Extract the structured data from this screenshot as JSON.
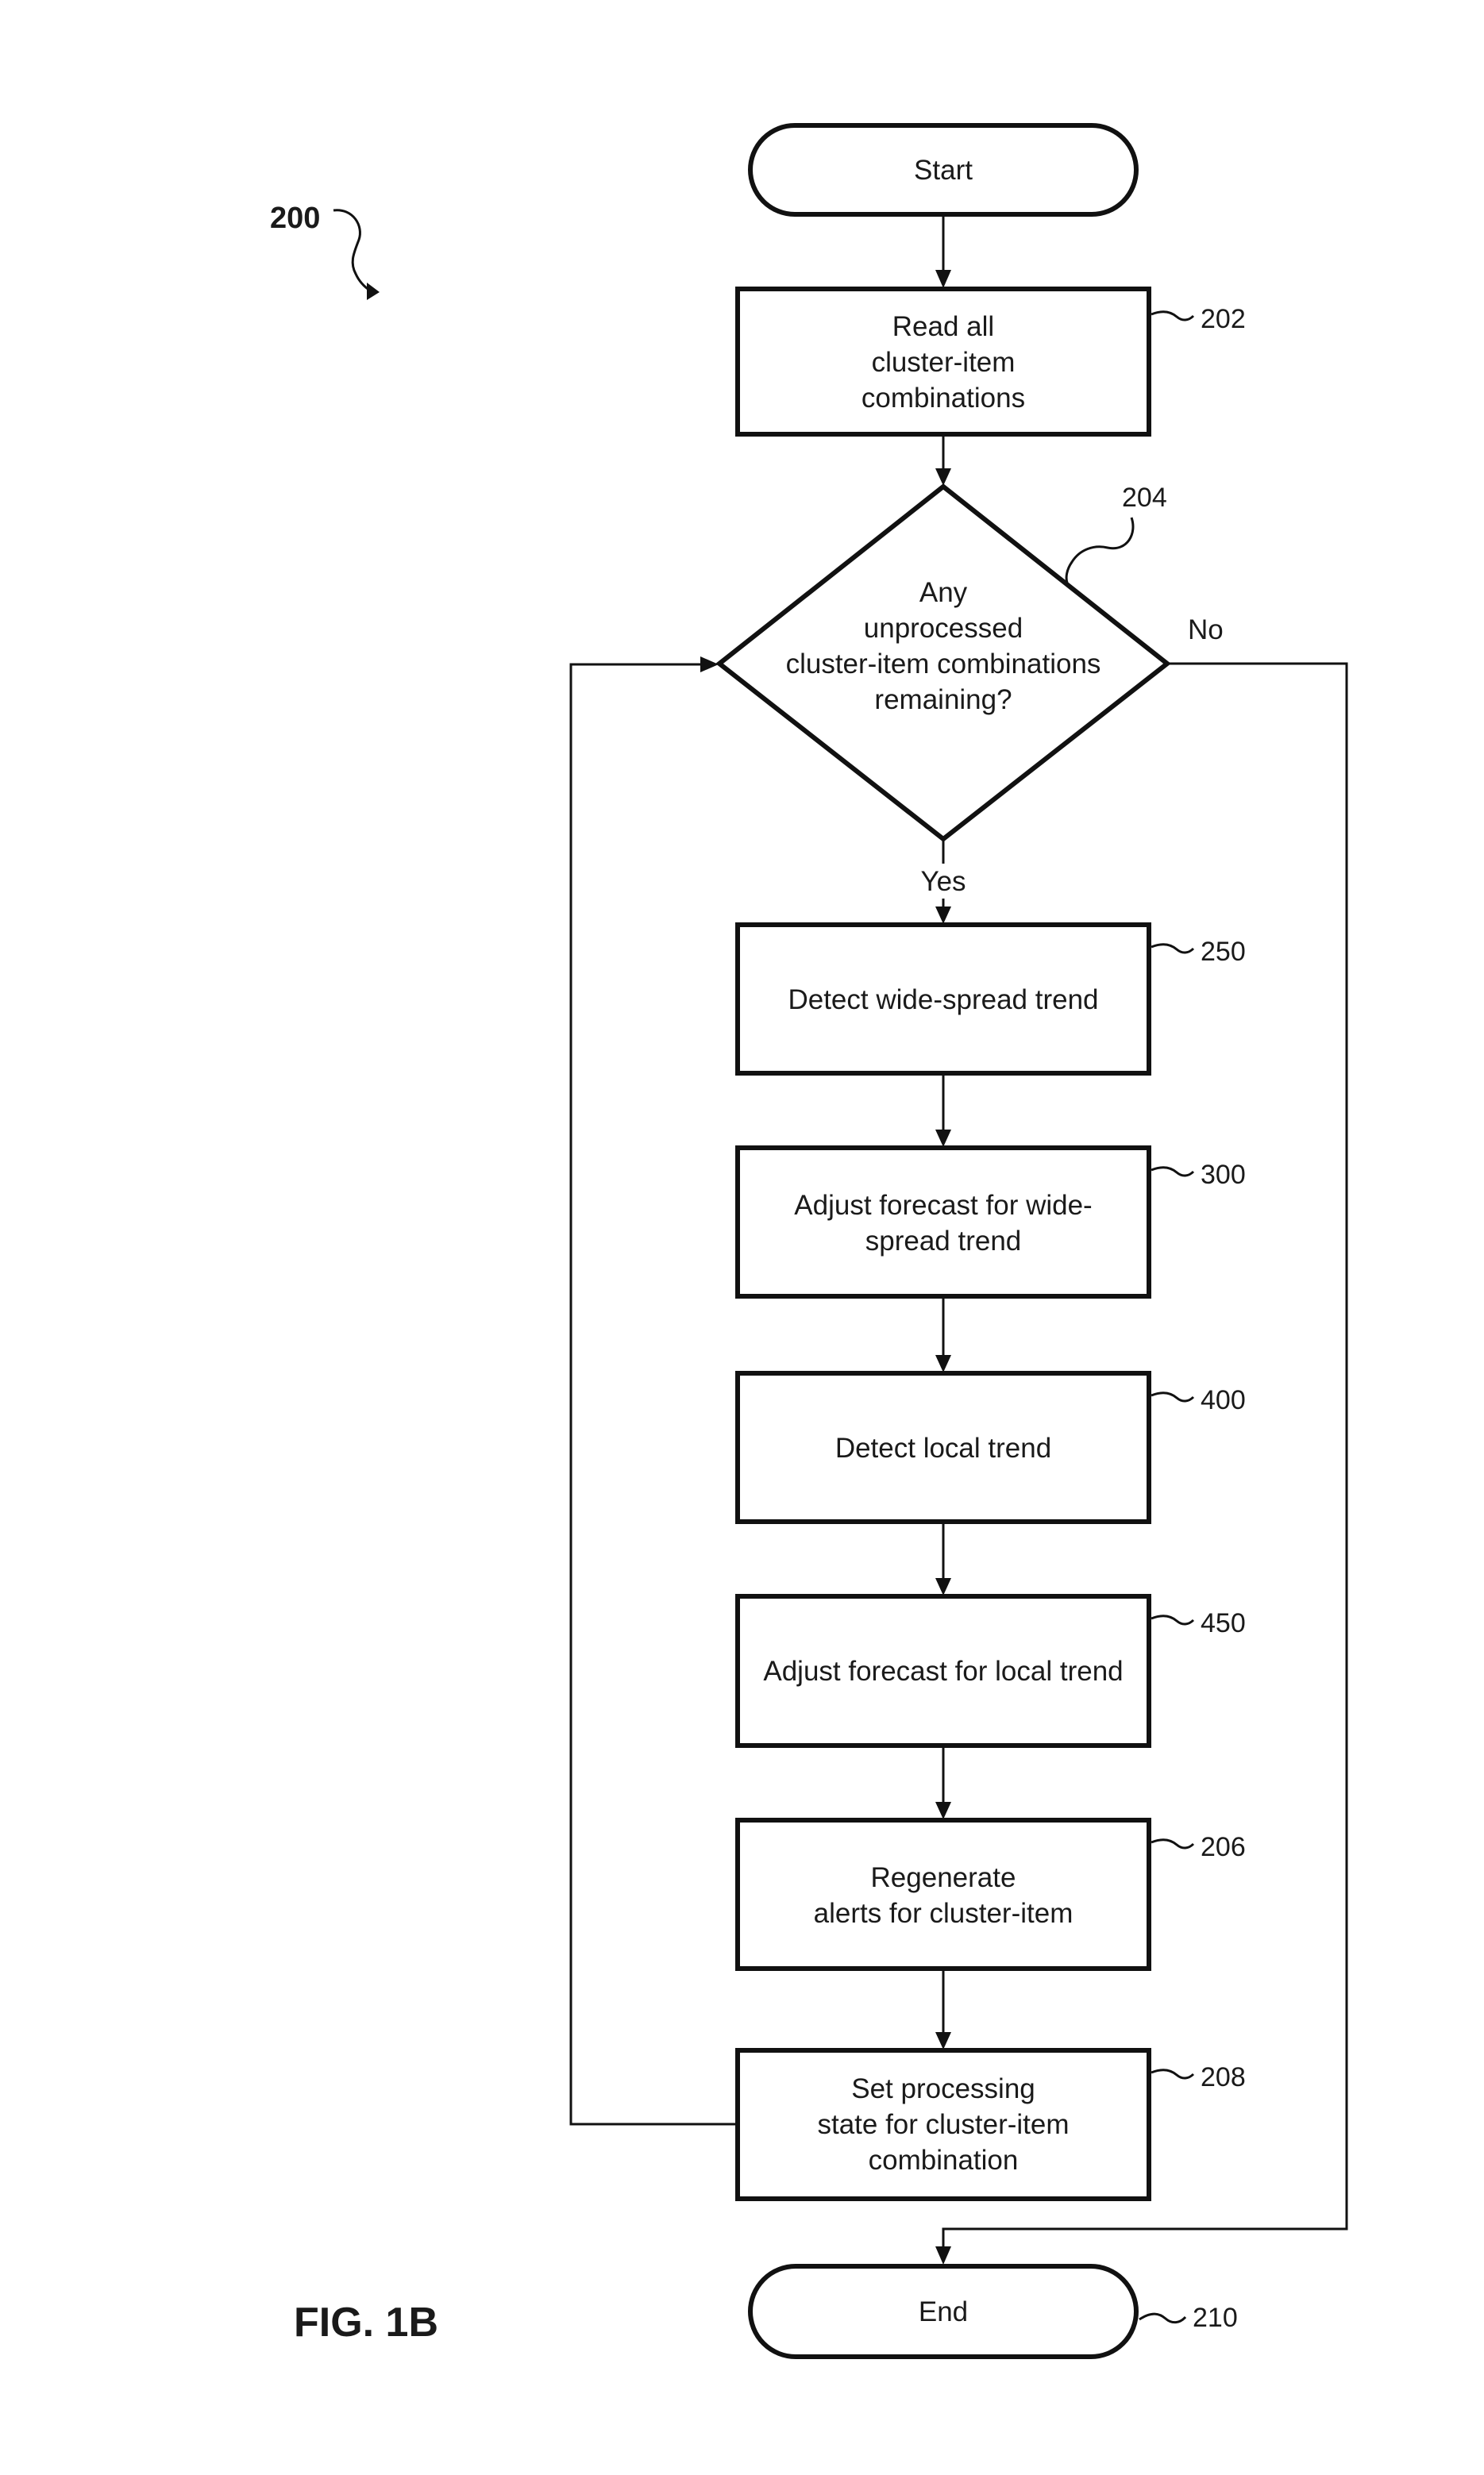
{
  "figure": {
    "label": "FIG. 1B",
    "number": "200"
  },
  "nodes": {
    "start": {
      "lines": [
        "Start"
      ]
    },
    "n202": {
      "ref": "202",
      "lines": [
        "Read all",
        "cluster-item",
        "combinations"
      ]
    },
    "n204": {
      "ref": "204",
      "lines": [
        "Any",
        "unprocessed",
        "cluster-item combinations",
        "remaining?"
      ]
    },
    "n250": {
      "ref": "250",
      "lines": [
        "Detect wide-spread trend"
      ]
    },
    "n300": {
      "ref": "300",
      "lines": [
        "Adjust forecast for wide-",
        "spread trend"
      ]
    },
    "n400": {
      "ref": "400",
      "lines": [
        "Detect local trend"
      ]
    },
    "n450": {
      "ref": "450",
      "lines": [
        "Adjust forecast for local trend"
      ]
    },
    "n206": {
      "ref": "206",
      "lines": [
        "Regenerate",
        "alerts for cluster-item"
      ]
    },
    "n208": {
      "ref": "208",
      "lines": [
        "Set processing",
        "state for cluster-item",
        "combination"
      ]
    },
    "end": {
      "ref": "210",
      "lines": [
        "End"
      ]
    }
  },
  "branches": {
    "yes": "Yes",
    "no": "No"
  }
}
